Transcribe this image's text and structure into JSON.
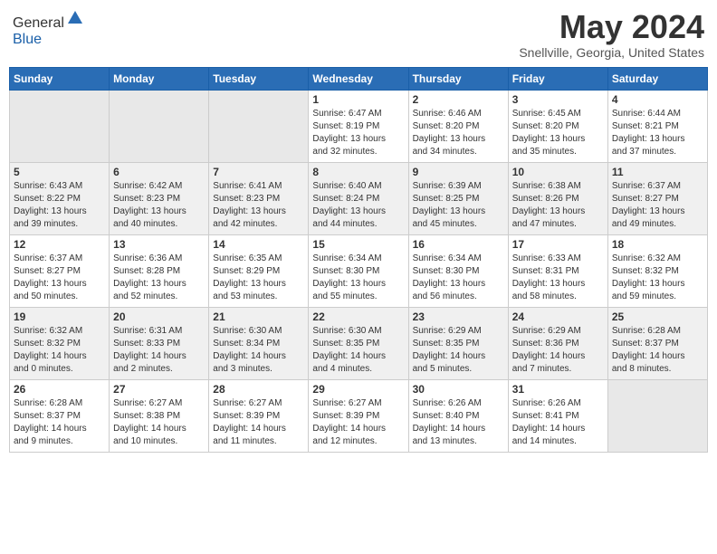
{
  "header": {
    "logo_general": "General",
    "logo_blue": "Blue",
    "month_title": "May 2024",
    "location": "Snellville, Georgia, United States"
  },
  "weekdays": [
    "Sunday",
    "Monday",
    "Tuesday",
    "Wednesday",
    "Thursday",
    "Friday",
    "Saturday"
  ],
  "weeks": [
    [
      {
        "day": "",
        "info": ""
      },
      {
        "day": "",
        "info": ""
      },
      {
        "day": "",
        "info": ""
      },
      {
        "day": "1",
        "info": "Sunrise: 6:47 AM\nSunset: 8:19 PM\nDaylight: 13 hours\nand 32 minutes."
      },
      {
        "day": "2",
        "info": "Sunrise: 6:46 AM\nSunset: 8:20 PM\nDaylight: 13 hours\nand 34 minutes."
      },
      {
        "day": "3",
        "info": "Sunrise: 6:45 AM\nSunset: 8:20 PM\nDaylight: 13 hours\nand 35 minutes."
      },
      {
        "day": "4",
        "info": "Sunrise: 6:44 AM\nSunset: 8:21 PM\nDaylight: 13 hours\nand 37 minutes."
      }
    ],
    [
      {
        "day": "5",
        "info": "Sunrise: 6:43 AM\nSunset: 8:22 PM\nDaylight: 13 hours\nand 39 minutes."
      },
      {
        "day": "6",
        "info": "Sunrise: 6:42 AM\nSunset: 8:23 PM\nDaylight: 13 hours\nand 40 minutes."
      },
      {
        "day": "7",
        "info": "Sunrise: 6:41 AM\nSunset: 8:23 PM\nDaylight: 13 hours\nand 42 minutes."
      },
      {
        "day": "8",
        "info": "Sunrise: 6:40 AM\nSunset: 8:24 PM\nDaylight: 13 hours\nand 44 minutes."
      },
      {
        "day": "9",
        "info": "Sunrise: 6:39 AM\nSunset: 8:25 PM\nDaylight: 13 hours\nand 45 minutes."
      },
      {
        "day": "10",
        "info": "Sunrise: 6:38 AM\nSunset: 8:26 PM\nDaylight: 13 hours\nand 47 minutes."
      },
      {
        "day": "11",
        "info": "Sunrise: 6:37 AM\nSunset: 8:27 PM\nDaylight: 13 hours\nand 49 minutes."
      }
    ],
    [
      {
        "day": "12",
        "info": "Sunrise: 6:37 AM\nSunset: 8:27 PM\nDaylight: 13 hours\nand 50 minutes."
      },
      {
        "day": "13",
        "info": "Sunrise: 6:36 AM\nSunset: 8:28 PM\nDaylight: 13 hours\nand 52 minutes."
      },
      {
        "day": "14",
        "info": "Sunrise: 6:35 AM\nSunset: 8:29 PM\nDaylight: 13 hours\nand 53 minutes."
      },
      {
        "day": "15",
        "info": "Sunrise: 6:34 AM\nSunset: 8:30 PM\nDaylight: 13 hours\nand 55 minutes."
      },
      {
        "day": "16",
        "info": "Sunrise: 6:34 AM\nSunset: 8:30 PM\nDaylight: 13 hours\nand 56 minutes."
      },
      {
        "day": "17",
        "info": "Sunrise: 6:33 AM\nSunset: 8:31 PM\nDaylight: 13 hours\nand 58 minutes."
      },
      {
        "day": "18",
        "info": "Sunrise: 6:32 AM\nSunset: 8:32 PM\nDaylight: 13 hours\nand 59 minutes."
      }
    ],
    [
      {
        "day": "19",
        "info": "Sunrise: 6:32 AM\nSunset: 8:32 PM\nDaylight: 14 hours\nand 0 minutes."
      },
      {
        "day": "20",
        "info": "Sunrise: 6:31 AM\nSunset: 8:33 PM\nDaylight: 14 hours\nand 2 minutes."
      },
      {
        "day": "21",
        "info": "Sunrise: 6:30 AM\nSunset: 8:34 PM\nDaylight: 14 hours\nand 3 minutes."
      },
      {
        "day": "22",
        "info": "Sunrise: 6:30 AM\nSunset: 8:35 PM\nDaylight: 14 hours\nand 4 minutes."
      },
      {
        "day": "23",
        "info": "Sunrise: 6:29 AM\nSunset: 8:35 PM\nDaylight: 14 hours\nand 5 minutes."
      },
      {
        "day": "24",
        "info": "Sunrise: 6:29 AM\nSunset: 8:36 PM\nDaylight: 14 hours\nand 7 minutes."
      },
      {
        "day": "25",
        "info": "Sunrise: 6:28 AM\nSunset: 8:37 PM\nDaylight: 14 hours\nand 8 minutes."
      }
    ],
    [
      {
        "day": "26",
        "info": "Sunrise: 6:28 AM\nSunset: 8:37 PM\nDaylight: 14 hours\nand 9 minutes."
      },
      {
        "day": "27",
        "info": "Sunrise: 6:27 AM\nSunset: 8:38 PM\nDaylight: 14 hours\nand 10 minutes."
      },
      {
        "day": "28",
        "info": "Sunrise: 6:27 AM\nSunset: 8:39 PM\nDaylight: 14 hours\nand 11 minutes."
      },
      {
        "day": "29",
        "info": "Sunrise: 6:27 AM\nSunset: 8:39 PM\nDaylight: 14 hours\nand 12 minutes."
      },
      {
        "day": "30",
        "info": "Sunrise: 6:26 AM\nSunset: 8:40 PM\nDaylight: 14 hours\nand 13 minutes."
      },
      {
        "day": "31",
        "info": "Sunrise: 6:26 AM\nSunset: 8:41 PM\nDaylight: 14 hours\nand 14 minutes."
      },
      {
        "day": "",
        "info": ""
      }
    ]
  ]
}
